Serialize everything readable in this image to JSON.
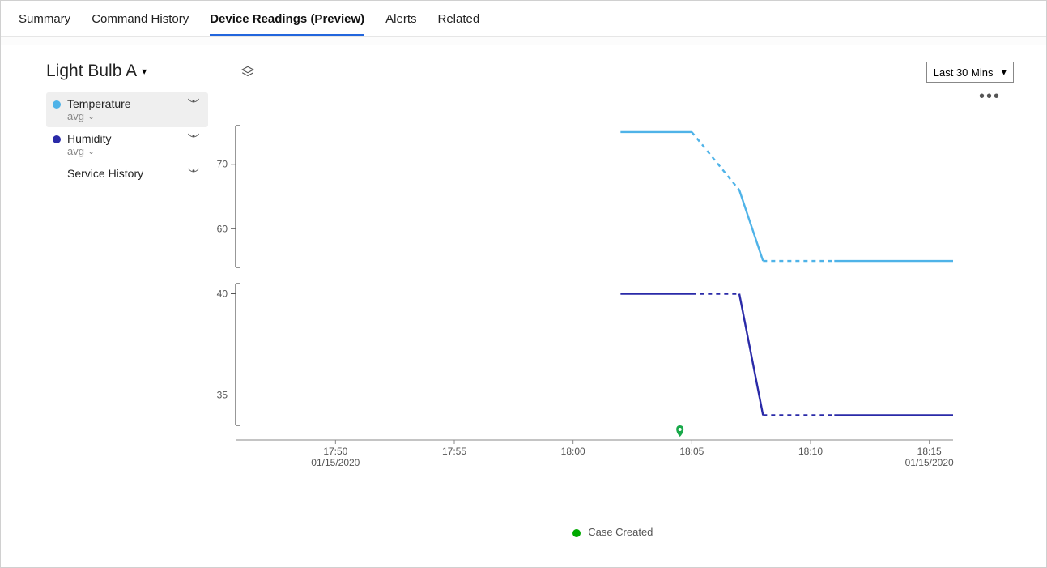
{
  "tabs": {
    "items": [
      "Summary",
      "Command History",
      "Device Readings (Preview)",
      "Alerts",
      "Related"
    ],
    "active_index": 2
  },
  "device": {
    "title": "Light Bulb A"
  },
  "series_panel": {
    "items": [
      {
        "name": "Temperature",
        "agg": "avg",
        "color": "#4fb3e8",
        "selected": true,
        "has_eye": true
      },
      {
        "name": "Humidity",
        "agg": "avg",
        "color": "#2a2aa8",
        "selected": false,
        "has_eye": true
      },
      {
        "name": "Service History",
        "agg": "",
        "color": "",
        "selected": false,
        "has_eye": true
      }
    ]
  },
  "toolbar": {
    "range_label": "Last 30 Mins"
  },
  "legend": {
    "marker_label": "Case Created"
  },
  "chart_data": {
    "type": "line",
    "x_ticks": [
      {
        "label": "17:50",
        "sub": "01/15/2020",
        "t": 1070
      },
      {
        "label": "17:55",
        "sub": "",
        "t": 1075
      },
      {
        "label": "18:00",
        "sub": "",
        "t": 1080
      },
      {
        "label": "18:05",
        "sub": "",
        "t": 1085
      },
      {
        "label": "18:10",
        "sub": "",
        "t": 1090
      },
      {
        "label": "18:15",
        "sub": "01/15/2020",
        "t": 1095
      }
    ],
    "x_range": [
      1066,
      1096
    ],
    "panels": [
      {
        "series": "Temperature",
        "color": "#4fb3e8",
        "y_ticks": [
          60,
          70
        ],
        "y_range": [
          54,
          76
        ],
        "segments": [
          {
            "style": "solid",
            "points": [
              [
                1082,
                75
              ],
              [
                1085,
                75
              ]
            ]
          },
          {
            "style": "dashed",
            "points": [
              [
                1085,
                75
              ],
              [
                1087,
                66
              ]
            ]
          },
          {
            "style": "solid",
            "points": [
              [
                1087,
                66
              ],
              [
                1088,
                55
              ]
            ]
          },
          {
            "style": "dashed",
            "points": [
              [
                1088,
                55
              ],
              [
                1091,
                55
              ]
            ]
          },
          {
            "style": "solid",
            "points": [
              [
                1091,
                55
              ],
              [
                1096,
                55
              ]
            ]
          }
        ]
      },
      {
        "series": "Humidity",
        "color": "#2a2aa8",
        "y_ticks": [
          35,
          40
        ],
        "y_range": [
          33.5,
          40.5
        ],
        "segments": [
          {
            "style": "solid",
            "points": [
              [
                1082,
                40
              ],
              [
                1085,
                40
              ]
            ]
          },
          {
            "style": "dashed",
            "points": [
              [
                1085,
                40
              ],
              [
                1087,
                40
              ]
            ]
          },
          {
            "style": "solid",
            "points": [
              [
                1087,
                40
              ],
              [
                1088,
                34
              ]
            ]
          },
          {
            "style": "dashed",
            "points": [
              [
                1088,
                34
              ],
              [
                1091,
                34
              ]
            ]
          },
          {
            "style": "solid",
            "points": [
              [
                1091,
                34
              ],
              [
                1096,
                34
              ]
            ]
          }
        ]
      }
    ],
    "event_markers": [
      {
        "t": 1084.5,
        "label": "Case Created",
        "color": "#19a94a"
      }
    ]
  }
}
